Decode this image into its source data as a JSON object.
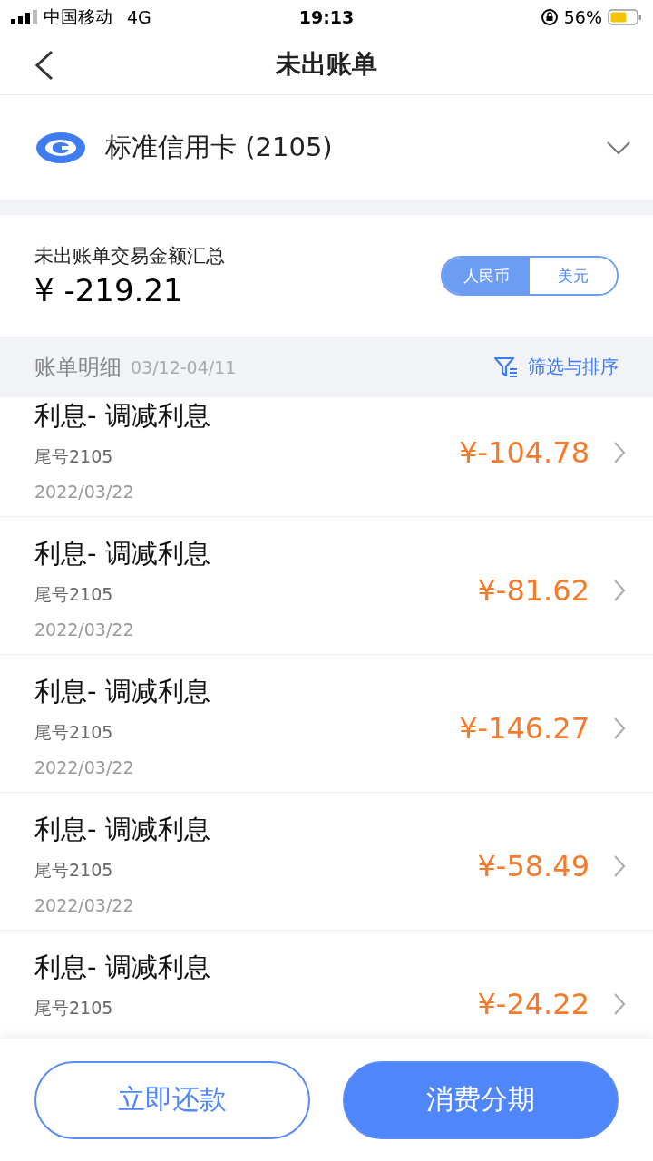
{
  "status_bar": {
    "carrier": "中国移动",
    "network": "4G",
    "time": "19:13",
    "battery": "56%"
  },
  "nav": {
    "title": "未出账单"
  },
  "card": {
    "name": "标准信用卡 (2105)"
  },
  "summary": {
    "label": "未出账单交易金额汇总",
    "amount": "¥ -219.21",
    "currencies": [
      {
        "label": "人民币",
        "selected": true
      },
      {
        "label": "美元",
        "selected": false
      }
    ]
  },
  "detail_header": {
    "title": "账单明细",
    "range": "03/12-04/11",
    "filter": "筛选与排序"
  },
  "transactions": [
    {
      "title": "利息- 调减利息",
      "tail": "尾号2105",
      "date": "2022/03/22",
      "amount": "¥-104.78"
    },
    {
      "title": "利息- 调减利息",
      "tail": "尾号2105",
      "date": "2022/03/22",
      "amount": "¥-81.62"
    },
    {
      "title": "利息- 调减利息",
      "tail": "尾号2105",
      "date": "2022/03/22",
      "amount": "¥-146.27"
    },
    {
      "title": "利息- 调减利息",
      "tail": "尾号2105",
      "date": "2022/03/22",
      "amount": "¥-58.49"
    },
    {
      "title": "利息- 调减利息",
      "tail": "尾号2105",
      "amount": "¥-24.22"
    }
  ],
  "buttons": [
    {
      "label": "立即还款",
      "kind": "outline"
    },
    {
      "label": "消费分期",
      "kind": "filled"
    }
  ]
}
